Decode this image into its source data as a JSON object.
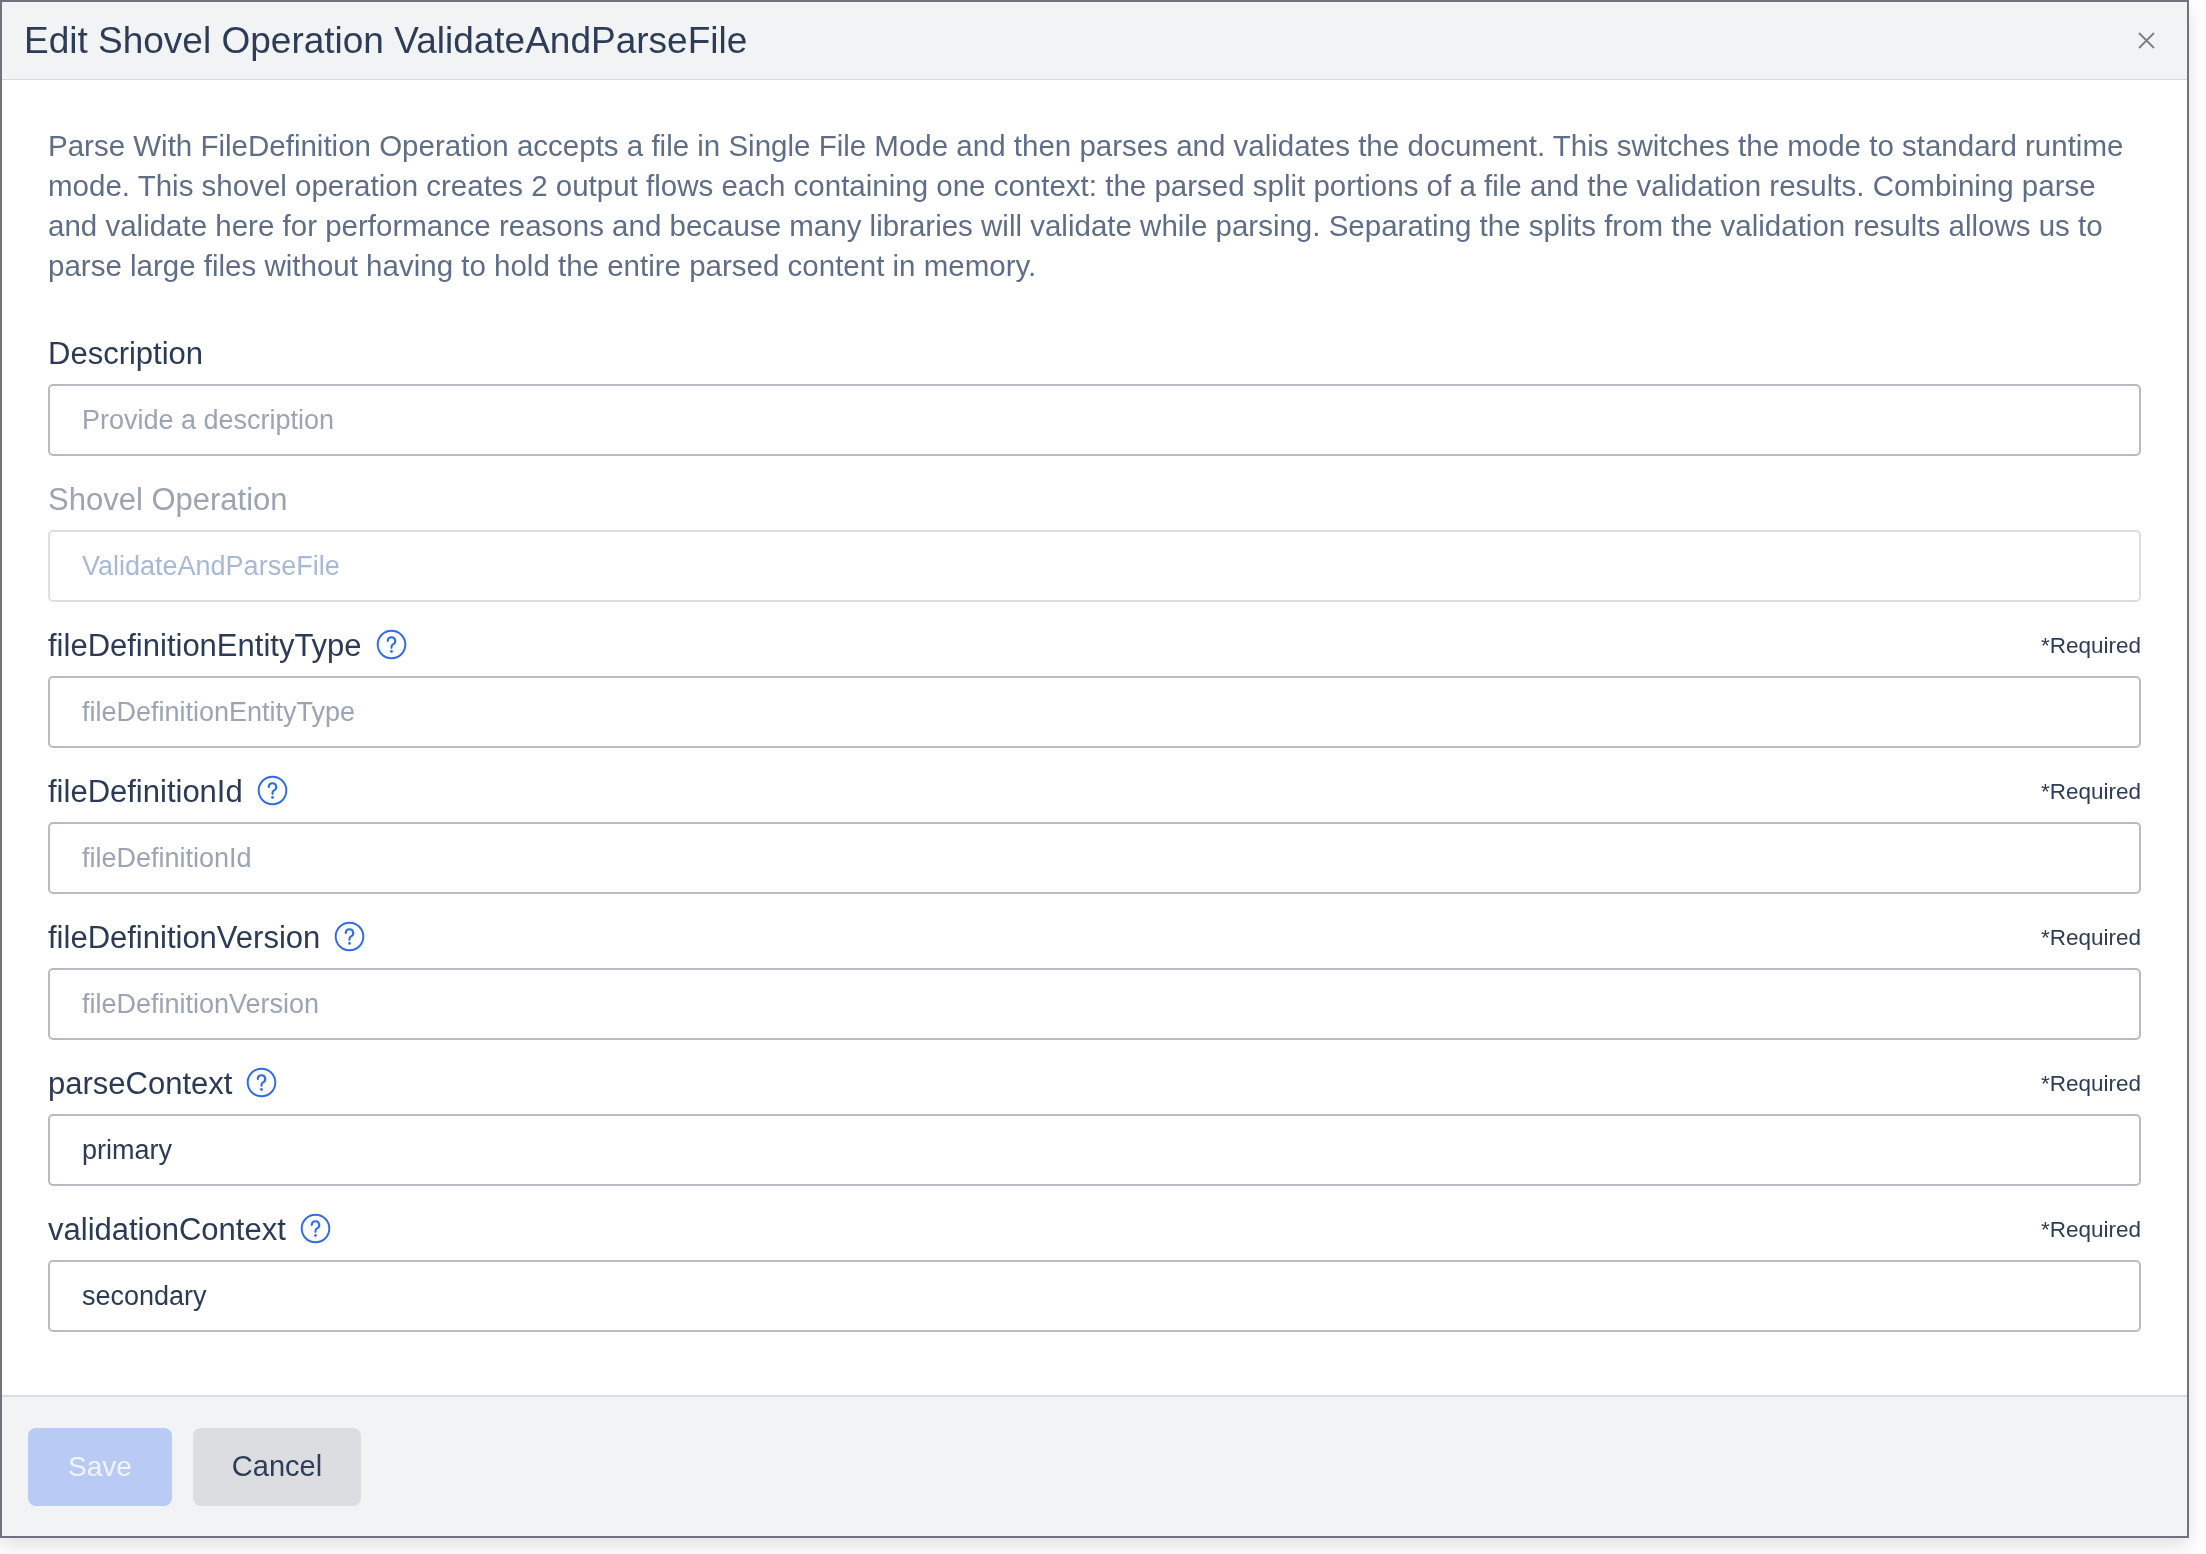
{
  "dialog": {
    "title": "Edit Shovel Operation ValidateAndParseFile",
    "intro": "Parse With FileDefinition Operation accepts a file in Single File Mode and then parses and validates the document. This switches the mode to standard runtime mode. This shovel operation creates 2 output flows each containing one context: the parsed split portions of a file and the validation results. Combining parse and validate here for performance reasons and because many libraries will validate while parsing. Separating the splits from the validation results allows us to parse large files without having to hold the entire parsed content in memory.",
    "fields": [
      {
        "label": "Description",
        "placeholder": "Provide a description",
        "disabled": false,
        "help": false
      },
      {
        "label": "Shovel Operation",
        "value": "ValidateAndParseFile",
        "disabled": true,
        "help": false
      },
      {
        "label": "fileDefinitionEntityType",
        "placeholder": "fileDefinitionEntityType",
        "disabled": false,
        "help": true,
        "required_note": "*Required"
      },
      {
        "label": "fileDefinitionId",
        "placeholder": "fileDefinitionId",
        "disabled": false,
        "help": true,
        "required_note": "*Required"
      },
      {
        "label": "fileDefinitionVersion",
        "placeholder": "fileDefinitionVersion",
        "disabled": false,
        "help": true,
        "required_note": "*Required"
      },
      {
        "label": "parseContext",
        "value": "primary",
        "disabled": false,
        "help": true,
        "required_note": "*Required"
      },
      {
        "label": "validationContext",
        "value": "secondary",
        "disabled": false,
        "help": true,
        "required_note": "*Required"
      }
    ],
    "buttons": [
      {
        "label": "Save",
        "kind": "primary",
        "disabled": true
      },
      {
        "label": "Cancel",
        "kind": "secondary",
        "disabled": false
      }
    ]
  }
}
